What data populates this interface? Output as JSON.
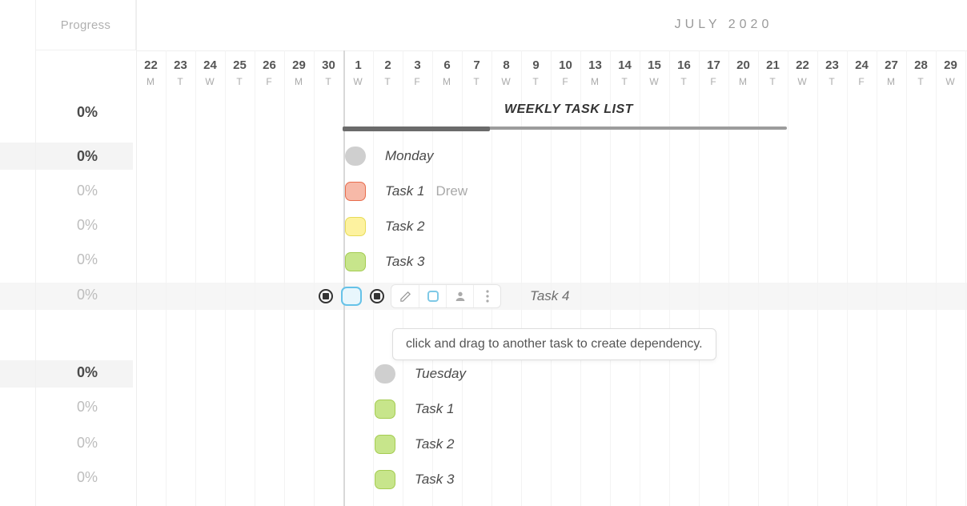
{
  "sidebar": {
    "header": "Progress",
    "rows": [
      "0%",
      "0%",
      "0%",
      "0%",
      "0%",
      "0%",
      "0%",
      "0%",
      "0%",
      "0%"
    ]
  },
  "calendar": {
    "month": "JULY 2020",
    "project_title": "WEEKLY TASK LIST",
    "days": [
      {
        "n": "22",
        "d": "M"
      },
      {
        "n": "23",
        "d": "T"
      },
      {
        "n": "24",
        "d": "W"
      },
      {
        "n": "25",
        "d": "T"
      },
      {
        "n": "26",
        "d": "F"
      },
      {
        "n": "29",
        "d": "M"
      },
      {
        "n": "30",
        "d": "T"
      },
      {
        "n": "1",
        "d": "W",
        "strong": true
      },
      {
        "n": "2",
        "d": "T"
      },
      {
        "n": "3",
        "d": "F"
      },
      {
        "n": "6",
        "d": "M"
      },
      {
        "n": "7",
        "d": "T"
      },
      {
        "n": "8",
        "d": "W"
      },
      {
        "n": "9",
        "d": "T"
      },
      {
        "n": "10",
        "d": "F"
      },
      {
        "n": "13",
        "d": "M"
      },
      {
        "n": "14",
        "d": "T"
      },
      {
        "n": "15",
        "d": "W"
      },
      {
        "n": "16",
        "d": "T"
      },
      {
        "n": "17",
        "d": "F"
      },
      {
        "n": "20",
        "d": "M"
      },
      {
        "n": "21",
        "d": "T"
      },
      {
        "n": "22",
        "d": "W"
      },
      {
        "n": "23",
        "d": "T"
      },
      {
        "n": "24",
        "d": "F"
      },
      {
        "n": "27",
        "d": "M"
      },
      {
        "n": "28",
        "d": "T"
      },
      {
        "n": "29",
        "d": "W"
      }
    ]
  },
  "tasks": {
    "monday": {
      "label": "Monday",
      "items": [
        {
          "name": "Task 1",
          "assignee": "Drew",
          "color": "red"
        },
        {
          "name": "Task 2",
          "color": "yellow"
        },
        {
          "name": "Task 3",
          "color": "green"
        },
        {
          "name": "Task 4",
          "color": "blue",
          "selected": true
        }
      ]
    },
    "tuesday": {
      "label": "Tuesday",
      "items": [
        {
          "name": "Task 1",
          "color": "green"
        },
        {
          "name": "Task 2",
          "color": "green"
        },
        {
          "name": "Task 3",
          "color": "green"
        }
      ]
    }
  },
  "tooltip": {
    "text": "click and drag to another task to create dependency."
  },
  "colors": {
    "red": "#f7b9a8",
    "yellow": "#fdf29f",
    "green": "#c7e58b",
    "blue": "#e8f6fc",
    "gray": "#cfcfcf"
  }
}
